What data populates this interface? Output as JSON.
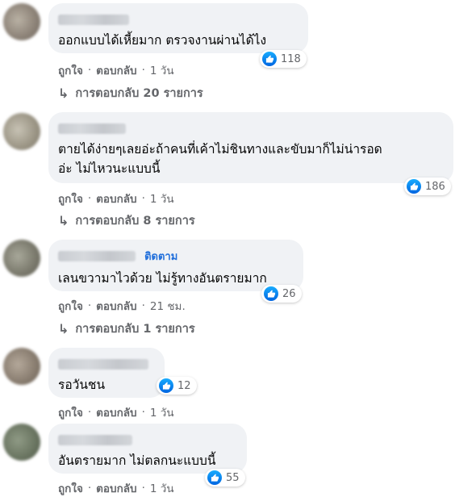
{
  "comments": [
    {
      "text": "ออกแบบได้เหี้ยมาก ตรวจงานผ่านได้ไง",
      "likes": "118",
      "like_label": "ถูกใจ",
      "reply_label": "ตอบกลับ",
      "sep": "·",
      "time": "1 วัน",
      "replies": "การตอบกลับ 20 รายการ"
    },
    {
      "text": "ตายได้ง่ายๆเลยอ่ะถ้าคนที่เค้าไม่ชินทางและขับมาก็ไม่น่ารอด\nอ่ะ ไม่ไหวนะแบบนี้",
      "likes": "186",
      "like_label": "ถูกใจ",
      "reply_label": "ตอบกลับ",
      "sep": "·",
      "time": "1 วัน",
      "replies": "การตอบกลับ 8 รายการ"
    },
    {
      "follow": "ติดตาม",
      "text": "เลนขวามาไวด้วย ไม่รู้ทางอันตรายมาก",
      "likes": "26",
      "like_label": "ถูกใจ",
      "reply_label": "ตอบกลับ",
      "sep": "·",
      "time": "21 ชม.",
      "replies": "การตอบกลับ 1 รายการ"
    },
    {
      "text": "รอวันชน",
      "likes": "12",
      "like_label": "ถูกใจ",
      "reply_label": "ตอบกลับ",
      "sep": "·",
      "time": "1 วัน"
    },
    {
      "text": "อันตรายมาก ไม่ตลกนะแบบนี้",
      "likes": "55",
      "like_label": "ถูกใจ",
      "reply_label": "ตอบกลับ",
      "sep": "·",
      "time": "1 วัน"
    }
  ],
  "icons": {
    "like": "thumbs-up-icon",
    "reply_arrow": "reply-arrow-icon"
  },
  "colors": {
    "like_blue": "#0a7cff",
    "link_blue": "#216fdb",
    "bubble": "#f0f2f5",
    "meta": "#65676b"
  }
}
